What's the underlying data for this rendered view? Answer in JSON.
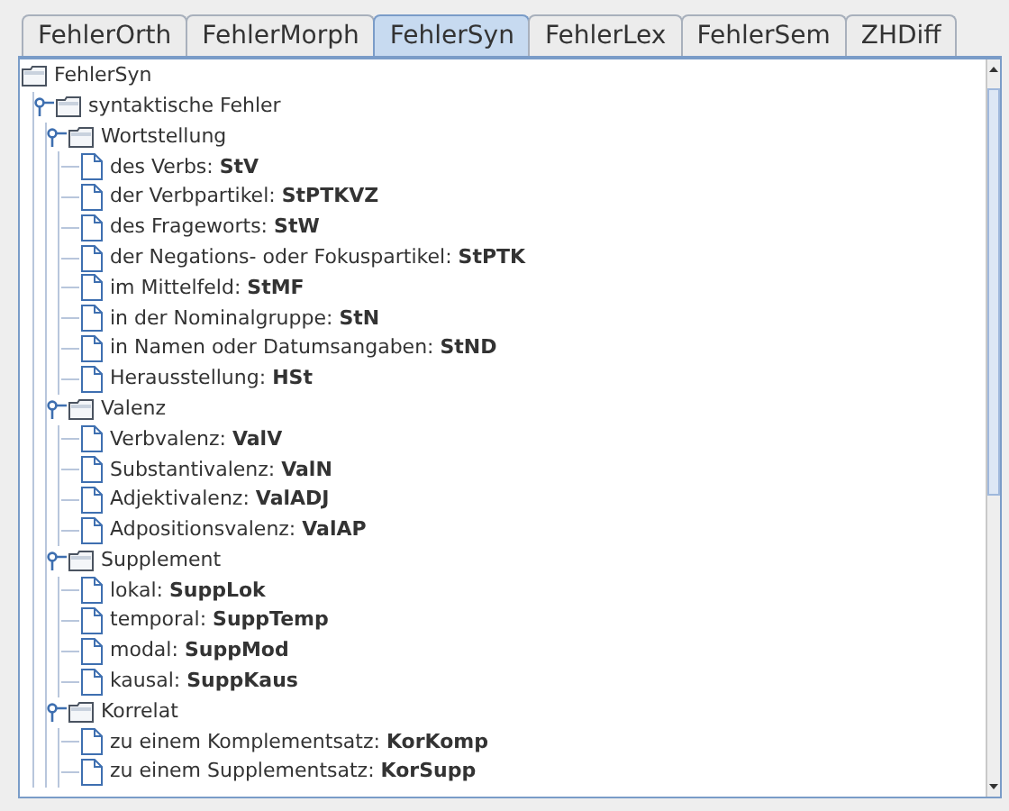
{
  "tabs": [
    {
      "label": "FehlerOrth",
      "selected": false
    },
    {
      "label": "FehlerMorph",
      "selected": false
    },
    {
      "label": "FehlerSyn",
      "selected": true
    },
    {
      "label": "FehlerLex",
      "selected": false
    },
    {
      "label": "FehlerSem",
      "selected": false
    },
    {
      "label": "ZHDiff",
      "selected": false
    }
  ],
  "tree": {
    "label": "FehlerSyn",
    "children": [
      {
        "label": "syntaktische Fehler",
        "expanded": true,
        "children": [
          {
            "label": "Wortstellung",
            "expanded": true,
            "children": [
              {
                "label": "des Verbs: **StV**"
              },
              {
                "label": "der Verbpartikel: **StPTKVZ**"
              },
              {
                "label": "des Frageworts: **StW**"
              },
              {
                "label": "der Negations- oder Fokuspartikel: **StPTK**"
              },
              {
                "label": "im Mittelfeld: **StMF**"
              },
              {
                "label": "in der Nominalgruppe: **StN**"
              },
              {
                "label": "in Namen oder Datumsangaben: **StND**"
              },
              {
                "label": "Herausstellung: **HSt**"
              }
            ]
          },
          {
            "label": "Valenz",
            "expanded": true,
            "children": [
              {
                "label": "Verbvalenz: **ValV**"
              },
              {
                "label": "Substantivalenz: **ValN**"
              },
              {
                "label": "Adjektivalenz: **ValADJ**"
              },
              {
                "label": "Adpositionsvalenz: **ValAP**"
              }
            ]
          },
          {
            "label": "Supplement",
            "expanded": true,
            "children": [
              {
                "label": "lokal: **SuppLok**"
              },
              {
                "label": "temporal: **SuppTemp**"
              },
              {
                "label": "modal: **SuppMod**"
              },
              {
                "label": "kausal: **SuppKaus**"
              }
            ]
          },
          {
            "label": "Korrelat",
            "expanded": true,
            "children": [
              {
                "label": "zu einem Komplementsatz: **KorKomp**"
              },
              {
                "label": "zu einem Supplementsatz: **KorSupp**"
              }
            ]
          }
        ]
      }
    ]
  }
}
